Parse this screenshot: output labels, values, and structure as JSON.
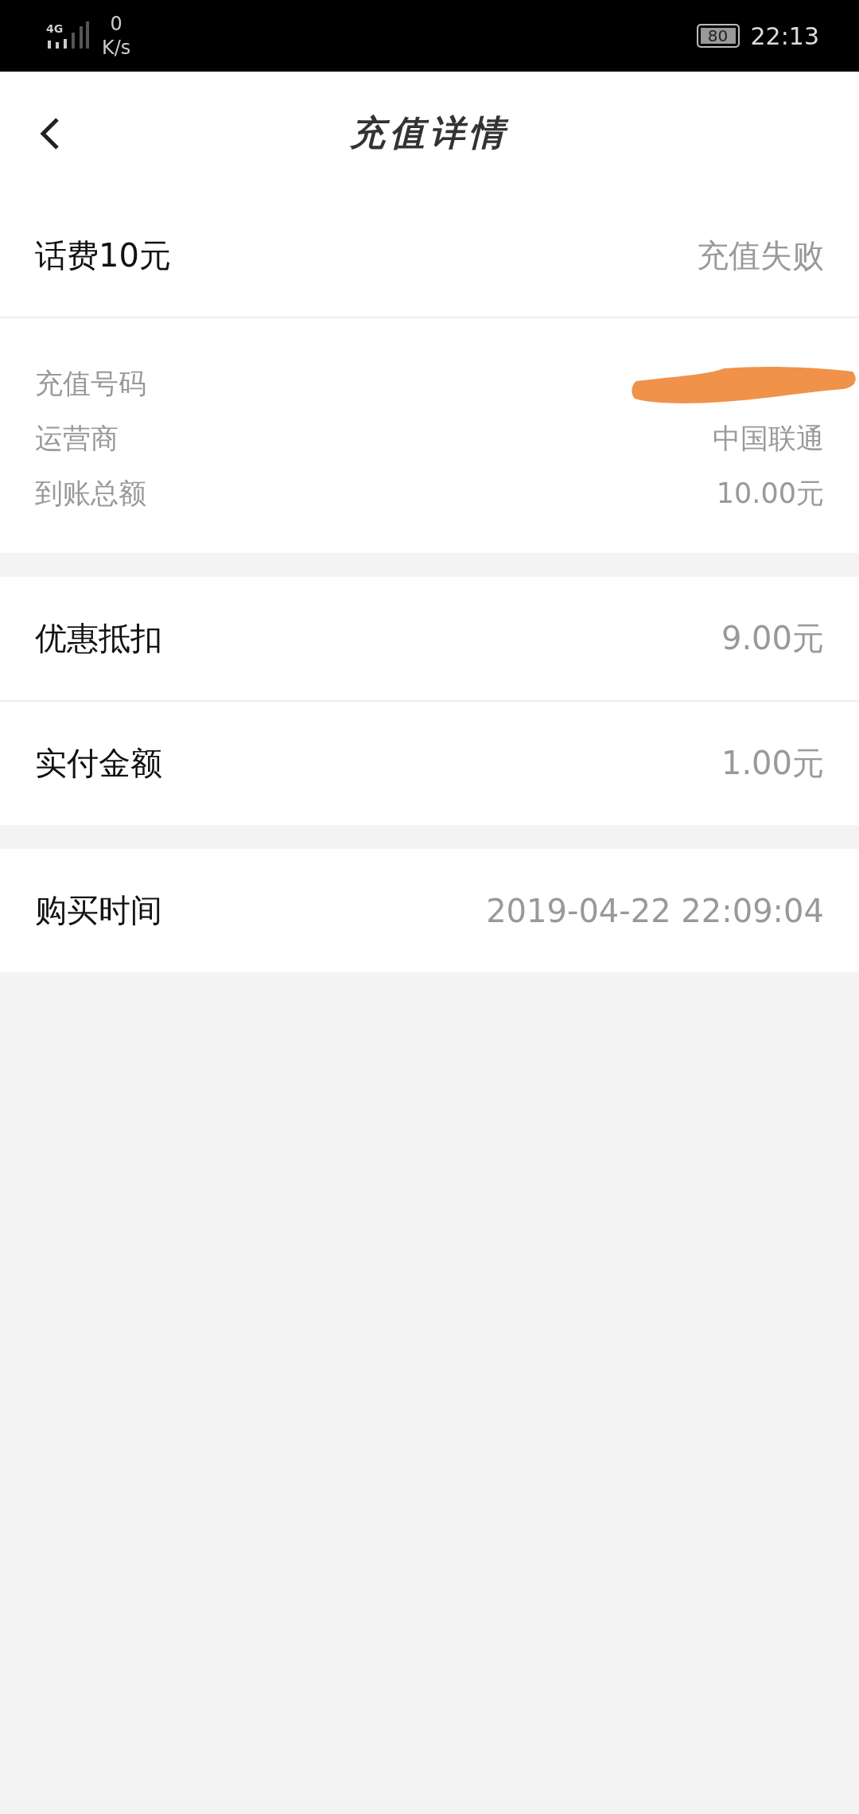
{
  "status_bar": {
    "network": "4G",
    "speed_value": "0",
    "speed_unit": "K/s",
    "battery": "80",
    "time": "22:13"
  },
  "header": {
    "title": "充值详情"
  },
  "summary": {
    "product": "话费10元",
    "status": "充值失败"
  },
  "details": [
    {
      "label": "充值号码",
      "redacted": true
    },
    {
      "label": "运营商",
      "value": "中国联通",
      "redacted": false
    },
    {
      "label": "到账总额",
      "value": "10.00元",
      "redacted": false
    }
  ],
  "payment": [
    {
      "label": "优惠抵扣",
      "value": "9.00元"
    },
    {
      "label": "实付金额",
      "value": "1.00元"
    }
  ],
  "purchase": {
    "label": "购买时间",
    "value": "2019-04-22 22:09:04"
  }
}
